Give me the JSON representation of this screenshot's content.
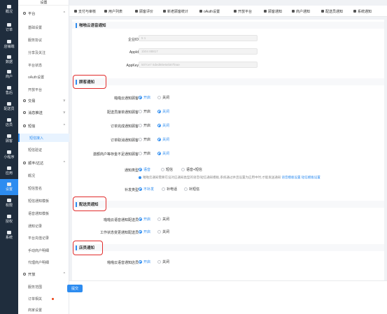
{
  "rail": [
    {
      "label": "概况"
    },
    {
      "label": "订单"
    },
    {
      "label": "店铺端"
    },
    {
      "label": "数据"
    },
    {
      "label": "商户"
    },
    {
      "label": "售后"
    },
    {
      "label": "配送员"
    },
    {
      "label": "店员"
    },
    {
      "label": "顾客"
    },
    {
      "label": "小程序"
    },
    {
      "label": "应用"
    },
    {
      "label": "设置"
    },
    {
      "label": "权限"
    },
    {
      "label": "授权"
    },
    {
      "label": "系统"
    }
  ],
  "sidebar": {
    "top": "设置",
    "groups": {
      "platform": "平台",
      "pay": "交易",
      "message": "消息推送",
      "sms": "短信",
      "dada": "顺丰/达达",
      "open": "开放"
    },
    "items": {
      "basic": "基础设置",
      "service": "服务协议",
      "share": "分享及关注",
      "status": "平台状态",
      "oauth": "oAuth设置",
      "open_platform": "开放平台",
      "sms_access": "短信接入",
      "sms_verify": "短信验证",
      "overview": "概况",
      "sms_sign": "短信签名",
      "sms_template": "短信通知模板",
      "voice_template": "语音通知模板",
      "notify_log": "通知记录",
      "recharge_log": "平台充值记录",
      "merchant_detail": "手动商户明细",
      "agent_detail": "代理商户明细",
      "service_scope": "服务范围",
      "order_rel": "订单相关",
      "store_settings": "商家设置"
    }
  },
  "tabs": [
    "支付与审核",
    "用户列表",
    "顾客评价",
    "新老顾客统计",
    "oAuth设置",
    "开放平台",
    "顾客通知",
    "商户通知",
    "配送员通知",
    "系统通知"
  ],
  "main": {
    "section_top": "啪啪云语音通知",
    "enterprise_id_label": "企业ID",
    "enterprise_id_value": "5     1",
    "appid_label": "AppId",
    "appid_value": "1b04           88817",
    "appkey_label": "AppKey",
    "appkey_value": "507ce7               6ded80e6eb87feae",
    "customer_section": "顾客通知",
    "customer_rows": [
      {
        "label": "啪啪云通知顾客",
        "on": "开启",
        "off": "关闭",
        "selected": "on"
      },
      {
        "label": "配送员接单通知顾客",
        "on": "开启",
        "off": "关闭",
        "selected": "off"
      },
      {
        "label": "订单完成通知顾客",
        "on": "开启",
        "off": "关闭",
        "selected": "off"
      },
      {
        "label": "订单取消通知顾客",
        "on": "开启",
        "off": "关闭",
        "selected": "off"
      },
      {
        "label": "激额商户等存金不足通知顾客",
        "on": "开启",
        "off": "关闭",
        "selected": "off"
      }
    ],
    "notify_type_label": "通知类型",
    "notify_type_options": [
      "语音",
      "短信",
      "语音+短信"
    ],
    "notify_hint_prefix": "啪啪云通知需要在设对应通知类型的语音/短信通知模板,系统通过并且设置为应用中时,才能发送通知",
    "notify_hint_link1": "语音模板设置",
    "notify_hint_link2": "短信模板设置",
    "supplement_label": "补发类型",
    "supplement_options": [
      "不补发",
      "补电话",
      "补短信"
    ],
    "courier_section": "配送员通知",
    "courier_rows": [
      {
        "label": "啪啪云语音通知配送员",
        "on": "开启",
        "off": "关闭",
        "selected": "on"
      },
      {
        "label": "工作状态变更通知配送员",
        "on": "开启",
        "off": "关闭",
        "selected": "on"
      }
    ],
    "store_section": "店员通知",
    "store_rows": [
      {
        "label": "啪啪云语音通知店员",
        "on": "开启",
        "off": "关闭",
        "selected": "on"
      }
    ],
    "submit": "提交"
  },
  "colors": {
    "accent": "#2d8cf0",
    "highlight": "#e12c2c",
    "rail": "#1f2d3d"
  }
}
